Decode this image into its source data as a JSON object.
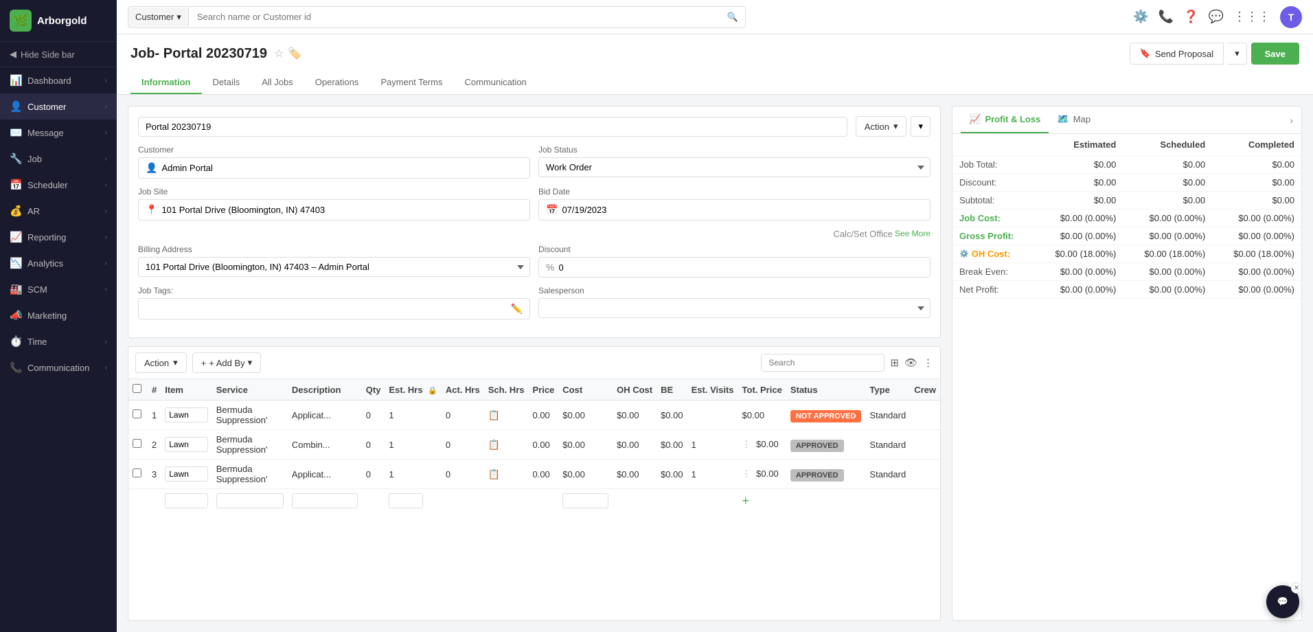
{
  "logo": {
    "text": "Arborgold",
    "icon": "🌿"
  },
  "sidebar": {
    "hide_label": "Hide Side bar",
    "items": [
      {
        "id": "dashboard",
        "label": "Dashboard",
        "icon": "📊",
        "active": false
      },
      {
        "id": "customer",
        "label": "Customer",
        "icon": "👤",
        "active": true
      },
      {
        "id": "message",
        "label": "Message",
        "icon": "✉️",
        "active": false
      },
      {
        "id": "job",
        "label": "Job",
        "icon": "🔧",
        "active": false
      },
      {
        "id": "scheduler",
        "label": "Scheduler",
        "icon": "📅",
        "active": false
      },
      {
        "id": "ar",
        "label": "AR",
        "icon": "💰",
        "active": false
      },
      {
        "id": "reporting",
        "label": "Reporting",
        "icon": "📈",
        "active": false
      },
      {
        "id": "analytics",
        "label": "Analytics",
        "icon": "📉",
        "active": false
      },
      {
        "id": "scm",
        "label": "SCM",
        "icon": "🏭",
        "active": false
      },
      {
        "id": "marketing",
        "label": "Marketing",
        "icon": "📣",
        "active": false
      },
      {
        "id": "time",
        "label": "Time",
        "icon": "⏱️",
        "active": false
      },
      {
        "id": "communication",
        "label": "Communication",
        "icon": "📞",
        "active": false
      }
    ]
  },
  "topbar": {
    "search_dropdown": "Customer",
    "search_placeholder": "Search name or Customer id",
    "avatar_label": "T"
  },
  "page": {
    "title": "Job- Portal 20230719",
    "send_proposal_label": "Send Proposal",
    "save_label": "Save"
  },
  "tabs": [
    {
      "id": "information",
      "label": "Information",
      "active": true
    },
    {
      "id": "details",
      "label": "Details",
      "active": false
    },
    {
      "id": "all_jobs",
      "label": "All Jobs",
      "active": false
    },
    {
      "id": "operations",
      "label": "Operations",
      "active": false
    },
    {
      "id": "payment_terms",
      "label": "Payment Terms",
      "active": false
    },
    {
      "id": "communication",
      "label": "Communication",
      "active": false
    }
  ],
  "form": {
    "job_name": "Portal 20230719",
    "action_label": "Action",
    "customer_label": "Customer",
    "customer_value": "Admin Portal",
    "job_status_label": "Job Status",
    "job_status_value": "Work Order",
    "job_site_label": "Job Site",
    "job_site_value": "101 Portal Drive (Bloomington, IN) 47403",
    "bid_date_label": "Bid Date",
    "bid_date_value": "07/19/2023",
    "calc_set_office": "Calc/Set Office",
    "see_more": "See More",
    "billing_address_label": "Billing Address",
    "billing_address_value": "101 Portal Drive (Bloomington, IN) 47403 – Admin Portal",
    "discount_label": "Discount",
    "discount_symbol": "%",
    "discount_value": "0",
    "job_tags_label": "Job Tags:",
    "salesperson_label": "Salesperson"
  },
  "table": {
    "action_label": "Action",
    "add_by_label": "+ Add By",
    "search_placeholder": "Search",
    "columns": [
      "#",
      "Item",
      "Service",
      "Description",
      "Qty",
      "Est. Hrs",
      "Act. Hrs",
      "Sch. Hrs",
      "Price",
      "Cost",
      "OH Cost",
      "BE",
      "Est. Visits",
      "Tot. Price",
      "Status",
      "Type",
      "Crew"
    ],
    "rows": [
      {
        "num": "1",
        "item": "Lawn",
        "service": "Bermuda Suppression'",
        "qty": "0",
        "description": "Applicat...",
        "est_hrs": "1",
        "act_hrs": "0",
        "sch_hrs": "",
        "price": "0.00",
        "cost": "0.00",
        "oh_cost": "0.00",
        "cost_val": "$0.00",
        "oh_cost_val": "$0.00",
        "be": "$0.00",
        "est_visits": "",
        "tot_price": "$0.00",
        "status": "NOT APPROVED",
        "status_class": "status-not-approved",
        "type": "Standard"
      },
      {
        "num": "2",
        "item": "Lawn",
        "service": "Bermuda Suppression'",
        "qty": "0",
        "description": "Combin...",
        "est_hrs": "1",
        "act_hrs": "0",
        "sch_hrs": "",
        "price": "0.00",
        "cost": "0.00",
        "oh_cost": "0.00",
        "cost_val": "$0.00",
        "oh_cost_val": "$0.00",
        "be": "$0.00",
        "est_visits": "1",
        "tot_price": "$0.00",
        "status": "APPROVED",
        "status_class": "status-approved",
        "type": "Standard"
      },
      {
        "num": "3",
        "item": "Lawn",
        "service": "Bermuda Suppression'",
        "qty": "0",
        "description": "Applicat...",
        "est_hrs": "1",
        "act_hrs": "0",
        "sch_hrs": "",
        "price": "0.00",
        "cost": "0.00",
        "oh_cost": "0.00",
        "cost_val": "$0.00",
        "oh_cost_val": "$0.00",
        "be": "$0.00",
        "est_visits": "1",
        "tot_price": "$0.00",
        "status": "APPROVED",
        "status_class": "status-approved",
        "type": "Standard"
      }
    ]
  },
  "right_panel": {
    "tabs": [
      {
        "id": "profit_loss",
        "label": "Profit & Loss",
        "icon": "📈",
        "active": true
      },
      {
        "id": "map",
        "label": "Map",
        "icon": "🗺️",
        "active": false
      }
    ],
    "pl": {
      "headers": [
        "",
        "Estimated",
        "Scheduled",
        "Completed"
      ],
      "rows": [
        {
          "label": "Job Total:",
          "estimated": "$0.00",
          "scheduled": "$0.00",
          "completed": "$0.00",
          "class": ""
        },
        {
          "label": "Discount:",
          "estimated": "$0.00",
          "scheduled": "$0.00",
          "completed": "$0.00",
          "class": ""
        },
        {
          "label": "Subtotal:",
          "estimated": "$0.00",
          "scheduled": "$0.00",
          "completed": "$0.00",
          "class": ""
        },
        {
          "label": "Job Cost:",
          "estimated": "$0.00 (0.00%)",
          "scheduled": "$0.00 (0.00%)",
          "completed": "$0.00 (0.00%)",
          "class": "label-green"
        },
        {
          "label": "Gross Profit:",
          "estimated": "$0.00 (0.00%)",
          "scheduled": "$0.00 (0.00%)",
          "completed": "$0.00 (0.00%)",
          "class": "label-green"
        },
        {
          "label": "OH Cost:",
          "estimated": "$0.00 (18.00%)",
          "scheduled": "$0.00 (18.00%)",
          "completed": "$0.00 (18.00%)",
          "class": "label-orange",
          "has_oh_icon": true
        },
        {
          "label": "Break Even:",
          "estimated": "$0.00 (0.00%)",
          "scheduled": "$0.00 (0.00%)",
          "completed": "$0.00 (0.00%)",
          "class": ""
        },
        {
          "label": "Net Profit:",
          "estimated": "$0.00 (0.00%)",
          "scheduled": "$0.00 (0.00%)",
          "completed": "$0.00 (0.00%)",
          "class": ""
        }
      ]
    }
  }
}
